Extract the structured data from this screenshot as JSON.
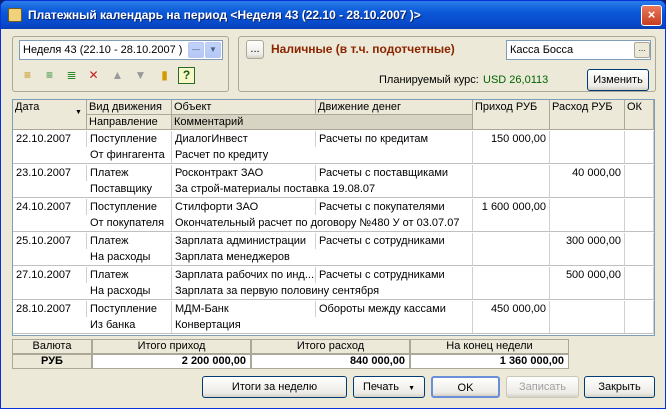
{
  "window": {
    "title": "Платежный календарь на период <Неделя 43  (22.10 - 28.10.2007 )>",
    "close": "×"
  },
  "period": {
    "value": "Неделя 43  (22.10 - 28.10.2007 )"
  },
  "cash": {
    "label": "Наличные (в т.ч. подотчетные)",
    "value": "Касса Босса",
    "ellipsis": "...",
    "rate_label": "Планируемый курс:",
    "rate_value": "USD 26,0113",
    "change_button": "Изменить"
  },
  "toolbar": {
    "icons": [
      "add-row-icon",
      "add-copy-icon",
      "edit-row-icon",
      "delete-row-icon",
      "move-up-icon",
      "move-down-icon",
      "sort-icon",
      "help-icon"
    ],
    "help": "?"
  },
  "grid": {
    "headers": {
      "date": "Дата",
      "movement": "Вид движения",
      "object": "Объект",
      "cashflow": "Движение денег",
      "income": "Приход РУБ",
      "expense": "Расход РУБ",
      "ok": "ОК",
      "direction": "Направление",
      "comment": "Комментарий"
    },
    "rows": [
      {
        "date": "22.10.2007",
        "movement": "Поступление",
        "object": "ДиалогИнвест",
        "cashflow": "Расчеты по кредитам",
        "income": "150 000,00",
        "expense": "",
        "direction": "От фингагента",
        "comment": "Расчет по кредиту"
      },
      {
        "date": "23.10.2007",
        "movement": "Платеж",
        "object": "Росконтракт  ЗАО",
        "cashflow": "Расчеты с поставщиками",
        "income": "",
        "expense": "40 000,00",
        "direction": "Поставщику",
        "comment": "За строй-материалы поставка 19.08.07"
      },
      {
        "date": "24.10.2007",
        "movement": "Поступление",
        "object": "Стилфорти  ЗАО",
        "cashflow": "Расчеты с покупателями",
        "income": "1 600 000,00",
        "expense": "",
        "direction": "От покупателя",
        "comment": "Окончательный расчет по договору №480 У от 03.07.07"
      },
      {
        "date": "25.10.2007",
        "movement": "Платеж",
        "object": "Зарплата администрации",
        "cashflow": "Расчеты с сотрудниками",
        "income": "",
        "expense": "300 000,00",
        "direction": "На расходы",
        "comment": "Зарплата менеджеров"
      },
      {
        "date": "27.10.2007",
        "movement": "Платеж",
        "object": "Зарплата рабочих по инд...",
        "cashflow": "Расчеты с сотрудниками",
        "income": "",
        "expense": "500 000,00",
        "direction": "На расходы",
        "comment": "Зарплата за первую половину сентября"
      },
      {
        "date": "28.10.2007",
        "movement": "Поступление",
        "object": "МДМ-Банк",
        "cashflow": "Обороты между кассами",
        "income": "450 000,00",
        "expense": "",
        "direction": "Из банка",
        "comment": "Конвертация"
      }
    ]
  },
  "totals": {
    "currency_label": "Валюта",
    "income_label": "Итого приход",
    "expense_label": "Итого расход",
    "end_label": "На конец недели",
    "currency": "РУБ",
    "income": "2 200 000,00",
    "expense": "840 000,00",
    "end": "1 360 000,00"
  },
  "buttons": {
    "week_totals": "Итоги за неделю",
    "print": "Печать",
    "ok": "OK",
    "save": "Записать",
    "close": "Закрыть"
  }
}
